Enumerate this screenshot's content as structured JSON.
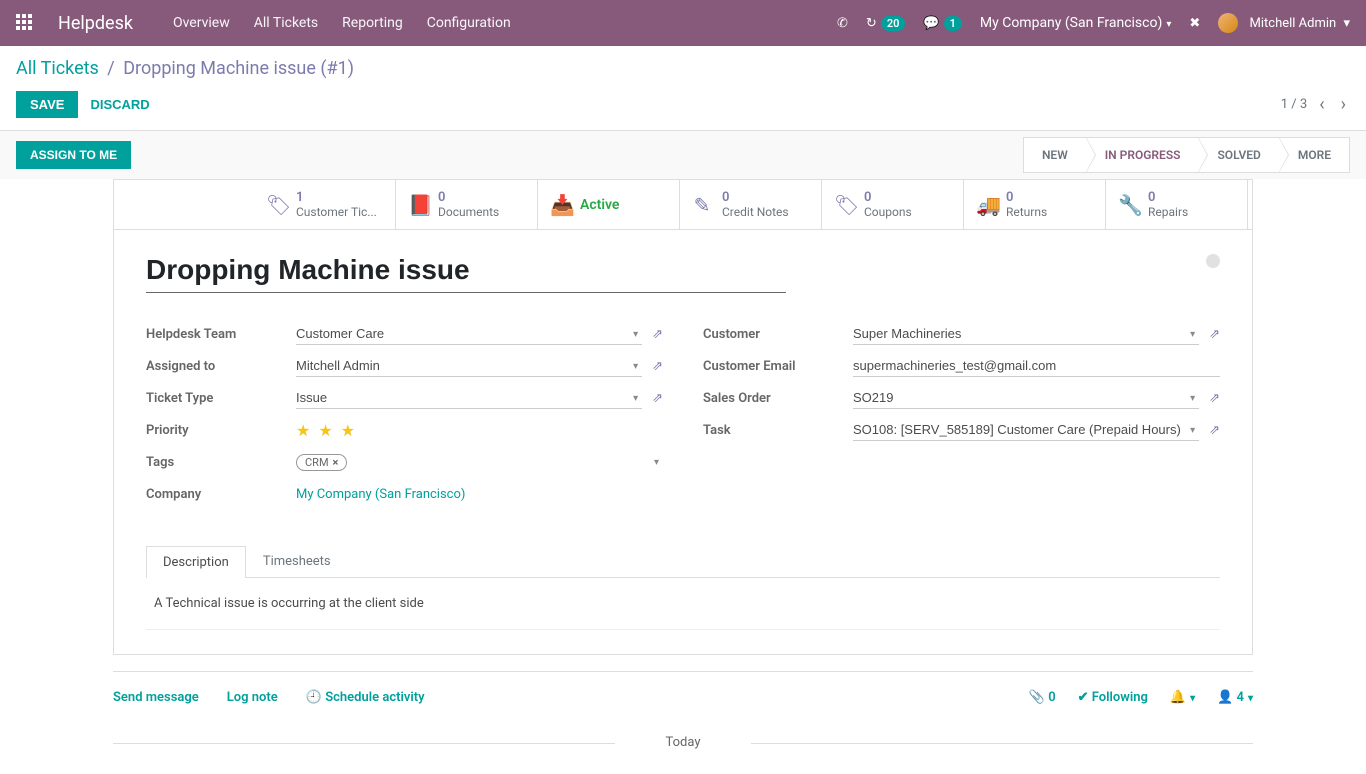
{
  "nav": {
    "brand": "Helpdesk",
    "links": [
      "Overview",
      "All Tickets",
      "Reporting",
      "Configuration"
    ],
    "clock_badge": "20",
    "chat_badge": "1",
    "company": "My Company (San Francisco)",
    "user": "Mitchell Admin"
  },
  "breadcrumb": {
    "root": "All Tickets",
    "current": "Dropping Machine issue (#1)"
  },
  "actions": {
    "save": "SAVE",
    "discard": "DISCARD",
    "pager": "1 / 3"
  },
  "statusbar": {
    "assign": "ASSIGN TO ME",
    "stages": [
      "NEW",
      "IN PROGRESS",
      "SOLVED"
    ],
    "more": "MORE"
  },
  "stat_buttons": [
    {
      "count": "1",
      "label": "Customer Tic..."
    },
    {
      "count": "0",
      "label": "Documents"
    },
    {
      "count": "",
      "label": "Active",
      "active": true
    },
    {
      "count": "0",
      "label": "Credit Notes"
    },
    {
      "count": "0",
      "label": "Coupons"
    },
    {
      "count": "0",
      "label": "Returns"
    },
    {
      "count": "0",
      "label": "Repairs"
    }
  ],
  "form": {
    "title": "Dropping Machine issue",
    "left": {
      "team_label": "Helpdesk Team",
      "team": "Customer Care",
      "assigned_label": "Assigned to",
      "assigned": "Mitchell Admin",
      "type_label": "Ticket Type",
      "type": "Issue",
      "priority_label": "Priority",
      "tags_label": "Tags",
      "tag1": "CRM",
      "company_label": "Company",
      "company": "My Company (San Francisco)"
    },
    "right": {
      "customer_label": "Customer",
      "customer": "Super Machineries",
      "email_label": "Customer Email",
      "email": "supermachineries_test@gmail.com",
      "so_label": "Sales Order",
      "so": "SO219",
      "task_label": "Task",
      "task": "SO108: [SERV_585189] Customer Care (Prepaid Hours)"
    }
  },
  "tabs": {
    "description": "Description",
    "timesheets": "Timesheets",
    "content": "A Technical issue is occurring at the client side"
  },
  "chatter": {
    "send": "Send message",
    "log": "Log note",
    "schedule": "Schedule activity",
    "attach": "0",
    "following": "Following",
    "followers": "4",
    "today": "Today"
  }
}
